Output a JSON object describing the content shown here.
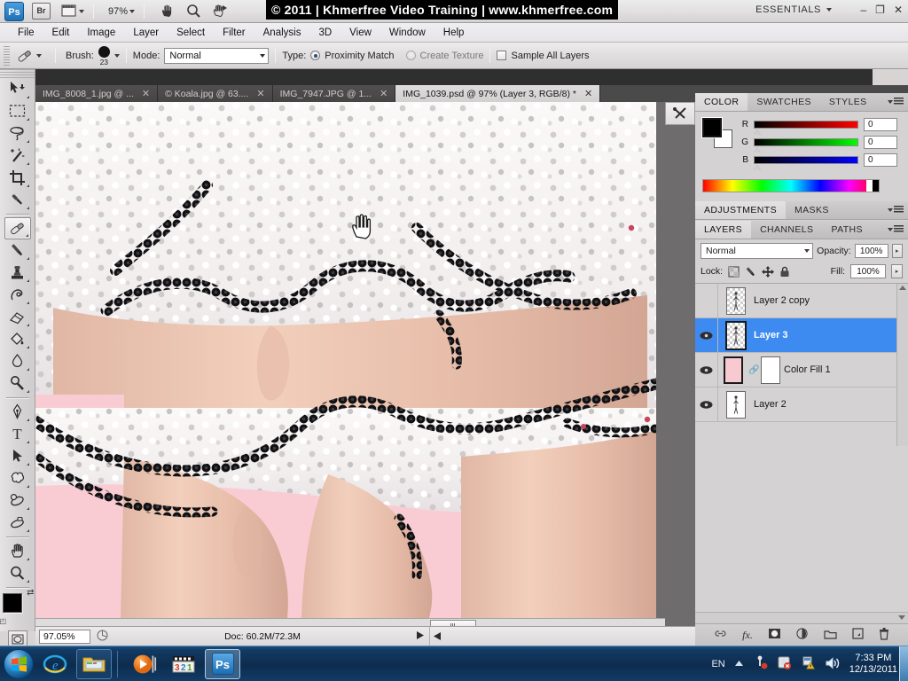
{
  "app": {
    "zoom_level": "97%",
    "banner": "© 2011 | Khmerfree Video Training | www.khmerfree.com",
    "workspace": "ESSENTIALS",
    "logo": "Ps",
    "bridge_label": "Br",
    "window_minimize": "–",
    "window_restore": "❐",
    "window_close": "✕"
  },
  "menu": {
    "items": [
      "File",
      "Edit",
      "Image",
      "Layer",
      "Select",
      "Filter",
      "Analysis",
      "3D",
      "View",
      "Window",
      "Help"
    ]
  },
  "options": {
    "brush_label": "Brush:",
    "brush_size": "23",
    "mode_label": "Mode:",
    "mode_value": "Normal",
    "type_label": "Type:",
    "proximity_match": "Proximity Match",
    "create_texture": "Create Texture",
    "sample_all_layers": "Sample All Layers"
  },
  "tabs": [
    {
      "label": "IMG_8008_1.jpg @ ...",
      "active": false,
      "close": "✕"
    },
    {
      "label": "© Koala.jpg @ 63....",
      "active": false,
      "close": "✕"
    },
    {
      "label": "IMG_7947.JPG @ 1...",
      "active": false,
      "close": "✕"
    },
    {
      "label": "IMG_1039.psd @ 97% (Layer 3, RGB/8) *",
      "active": true,
      "close": "✕"
    }
  ],
  "tools": [
    {
      "name": "move-tool",
      "selected": false
    },
    {
      "name": "rectangular-marquee-tool",
      "selected": false
    },
    {
      "name": "lasso-tool",
      "selected": false
    },
    {
      "name": "magic-wand-tool",
      "selected": false
    },
    {
      "name": "crop-tool",
      "selected": false
    },
    {
      "name": "eyedropper-tool",
      "selected": false
    },
    {
      "name": "spot-healing-brush-tool",
      "selected": true
    },
    {
      "name": "brush-tool",
      "selected": false
    },
    {
      "name": "clone-stamp-tool",
      "selected": false
    },
    {
      "name": "history-brush-tool",
      "selected": false
    },
    {
      "name": "eraser-tool",
      "selected": false
    },
    {
      "name": "gradient-tool",
      "selected": false
    },
    {
      "name": "blur-tool",
      "selected": false
    },
    {
      "name": "dodge-tool",
      "selected": false
    },
    {
      "name": "pen-tool",
      "selected": false
    },
    {
      "name": "type-tool",
      "selected": false
    },
    {
      "name": "path-selection-tool",
      "selected": false
    },
    {
      "name": "shape-tool",
      "selected": false
    },
    {
      "name": "3d-rotate-tool",
      "selected": false
    },
    {
      "name": "3d-orbit-tool",
      "selected": false
    },
    {
      "name": "hand-tool",
      "selected": false
    },
    {
      "name": "zoom-tool",
      "selected": false
    }
  ],
  "type_tool_glyph": "T",
  "color_panel": {
    "tabs": [
      "COLOR",
      "SWATCHES",
      "STYLES"
    ],
    "active_tab": "COLOR",
    "channels": [
      {
        "label": "R",
        "value": "0",
        "color": "#ff0000"
      },
      {
        "label": "G",
        "value": "0",
        "color": "#00ff00"
      },
      {
        "label": "B",
        "value": "0",
        "color": "#0000ff"
      }
    ],
    "foreground": "#000000",
    "background": "#ffffff"
  },
  "adjustments_panel": {
    "tabs": [
      "ADJUSTMENTS",
      "MASKS"
    ],
    "active_tab": "ADJUSTMENTS"
  },
  "layers_panel": {
    "tabs": [
      "LAYERS",
      "CHANNELS",
      "PATHS"
    ],
    "active_tab": "LAYERS",
    "blend_mode": "Normal",
    "opacity_label": "Opacity:",
    "opacity_value": "100%",
    "lock_label": "Lock:",
    "fill_label": "Fill:",
    "fill_value": "100%",
    "layers": [
      {
        "name": "Layer 2 copy",
        "visible": false,
        "selected": false,
        "kind": "transparent"
      },
      {
        "name": "Layer 3",
        "visible": true,
        "selected": true,
        "kind": "transparent"
      },
      {
        "name": "Color Fill 1",
        "visible": true,
        "selected": false,
        "kind": "fill",
        "fill_color": "#f8c9d0",
        "has_mask": true
      },
      {
        "name": "Layer 2",
        "visible": true,
        "selected": false,
        "kind": "white"
      }
    ],
    "footer_icons": [
      "link-icon",
      "fx-icon",
      "layer-mask-icon",
      "adjustment-layer-icon",
      "new-group-icon",
      "new-layer-icon",
      "delete-layer-icon"
    ]
  },
  "status_bar": {
    "zoom": "97.05%",
    "doc_info": "Doc: 60.2M/72.3M"
  },
  "taskbar": {
    "items": [
      "start-orb",
      "internet-explorer-icon",
      "windows-explorer-icon",
      "windows-media-player-icon",
      "calendar-321-icon",
      "photoshop-icon"
    ],
    "language": "EN",
    "time": "7:33 PM",
    "date": "12/13/2011"
  }
}
